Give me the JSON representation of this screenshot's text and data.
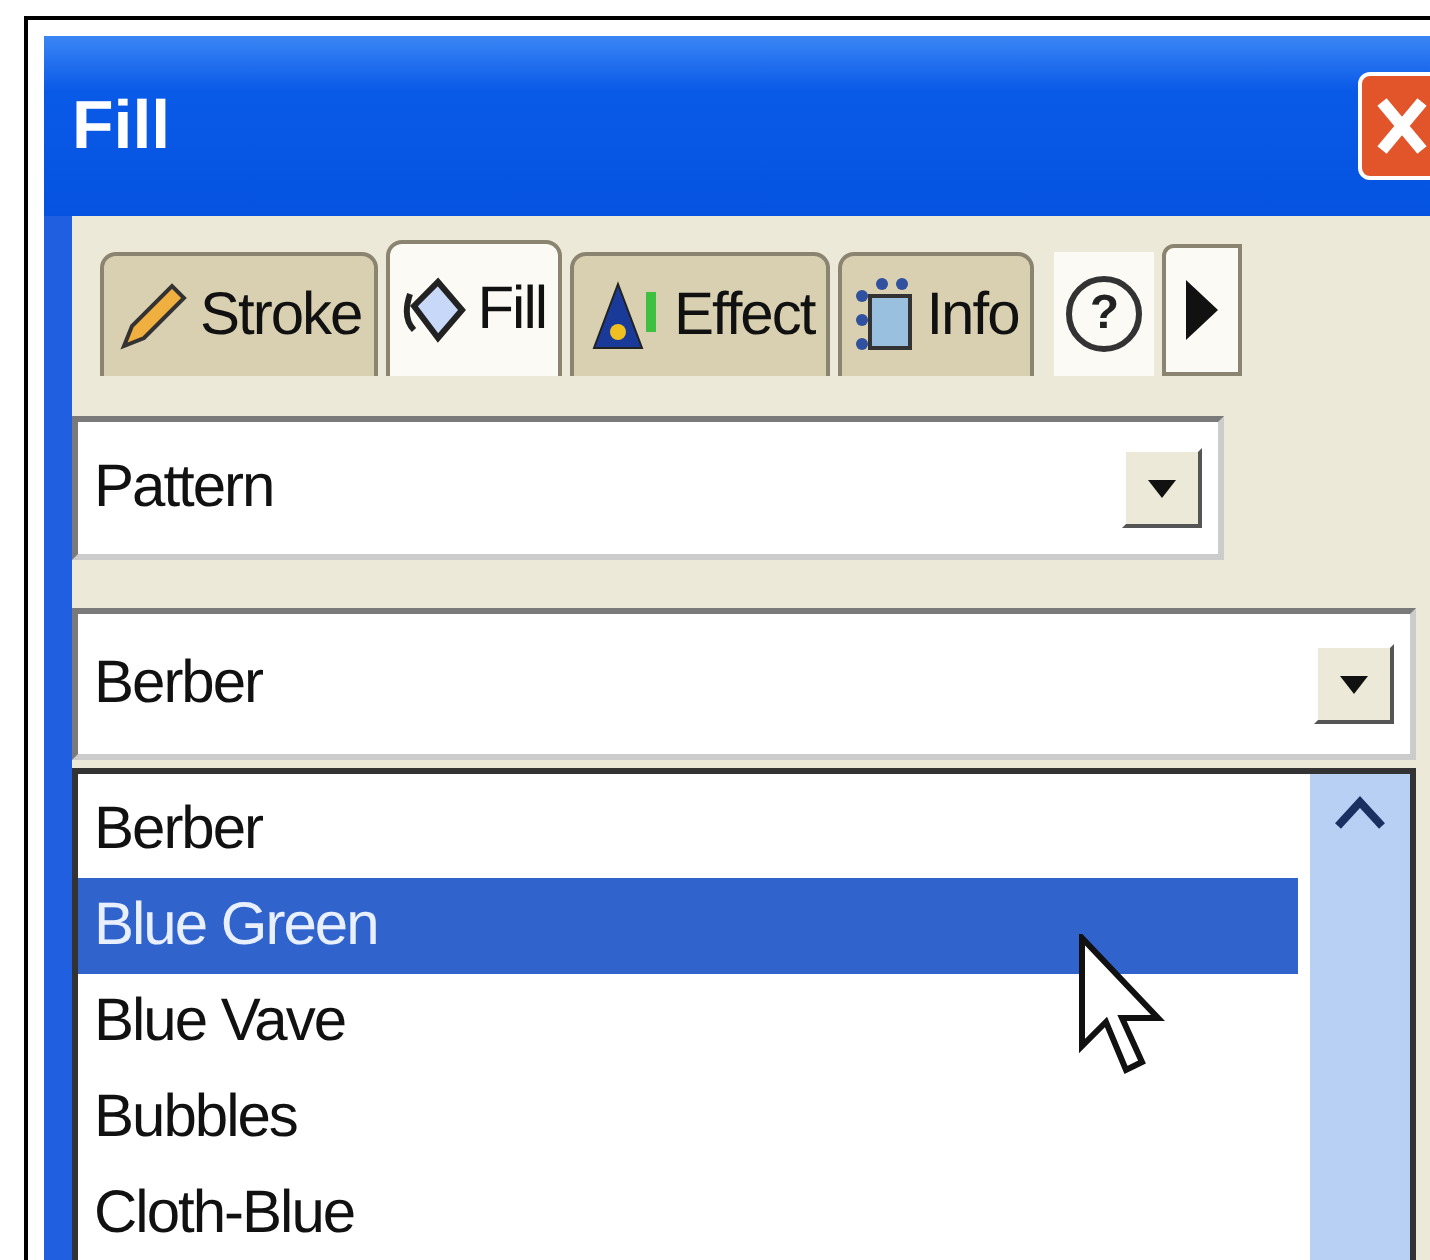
{
  "window": {
    "title": "Fill"
  },
  "tabs": [
    {
      "label": "Stroke",
      "kind": "pencil",
      "selected": false
    },
    {
      "label": "Fill",
      "kind": "bucket",
      "selected": true
    },
    {
      "label": "Effect",
      "kind": "wizard",
      "selected": false
    },
    {
      "label": "Info",
      "kind": "info",
      "selected": false
    }
  ],
  "help_button": {
    "label": "?"
  },
  "fill_type": {
    "value": "Pattern"
  },
  "pattern": {
    "value": "Berber"
  },
  "pattern_list": [
    {
      "label": "Berber",
      "selected": false
    },
    {
      "label": "Blue Green",
      "selected": true
    },
    {
      "label": "Blue Vave",
      "selected": false
    },
    {
      "label": "Bubbles",
      "selected": false
    },
    {
      "label": "Cloth-Blue",
      "selected": false
    }
  ]
}
